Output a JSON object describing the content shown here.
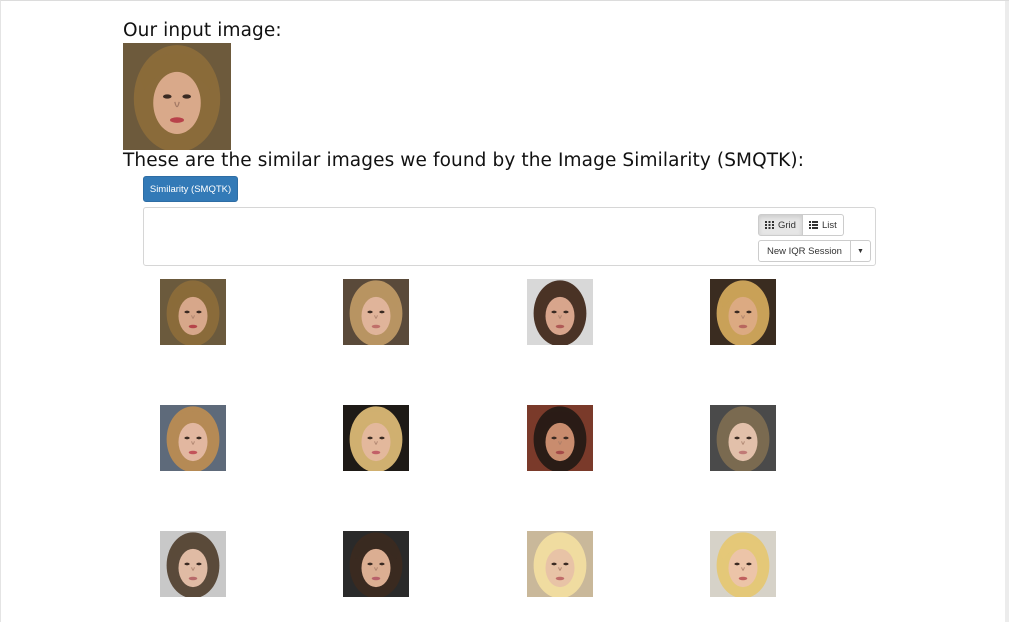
{
  "input_section": {
    "heading": "Our input image:",
    "image": {
      "subject": "face photo",
      "bg": "#6d5a3c",
      "hair": "#8a6b3a",
      "skin": "#d9a98a",
      "lips": "#b8424a"
    }
  },
  "results_section": {
    "heading": "These are the similar images we found by the Image Similarity (SMQTK):",
    "similarity_button_label": "Similarity (SMQTK)",
    "view_toggle": {
      "grid_label": "Grid",
      "list_label": "List",
      "active": "Grid"
    },
    "iqr_session_label": "New IQR Session",
    "results": [
      {
        "bg": "#6b5a3d",
        "hair": "#8a6b3a",
        "skin": "#d7a78a",
        "lips": "#b5454a"
      },
      {
        "bg": "#5a4a3a",
        "hair": "#b89462",
        "skin": "#e0b49a",
        "lips": "#c0706a"
      },
      {
        "bg": "#d8d8d8",
        "hair": "#4a3326",
        "skin": "#d8a58c",
        "lips": "#b05a56"
      },
      {
        "bg": "#3a2c20",
        "hair": "#c9a158",
        "skin": "#dcaa82",
        "lips": "#b8675e"
      },
      {
        "bg": "#5e6a7a",
        "hair": "#b58a55",
        "skin": "#e2b7a0",
        "lips": "#c2545a"
      },
      {
        "bg": "#1e1a16",
        "hair": "#d0b070",
        "skin": "#e3b89c",
        "lips": "#c26068"
      },
      {
        "bg": "#7a3a2a",
        "hair": "#2a1c16",
        "skin": "#c98c6e",
        "lips": "#a54a48"
      },
      {
        "bg": "#4a4a4a",
        "hair": "#7a6a50",
        "skin": "#e2c0aa",
        "lips": "#c07a76"
      },
      {
        "bg": "#c8c8c8",
        "hair": "#5a4a3a",
        "skin": "#e0bba4",
        "lips": "#b86a6a"
      },
      {
        "bg": "#2a2a2a",
        "hair": "#3a2a20",
        "skin": "#dbae92",
        "lips": "#b8606a"
      },
      {
        "bg": "#c9b89a",
        "hair": "#f0dca0",
        "skin": "#e8c3a6",
        "lips": "#c06c6a"
      },
      {
        "bg": "#d6d2c8",
        "hair": "#e4c878",
        "skin": "#ecc4a8",
        "lips": "#c0605e"
      }
    ]
  },
  "colors": {
    "primary_button": "#337ab7",
    "panel_border": "#d6d6d6",
    "active_toggle": "#e6e6e6"
  }
}
